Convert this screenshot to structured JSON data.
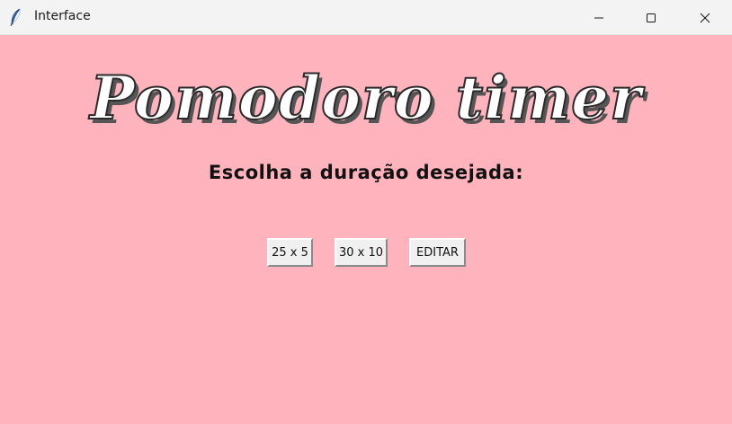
{
  "window": {
    "title": "Interface",
    "icon": "feather-icon",
    "controls": [
      "minimize-icon",
      "maximize-icon",
      "close-icon"
    ]
  },
  "main": {
    "heading": "Pomodoro timer",
    "subheading": "Escolha a duração desejada:",
    "buttons": {
      "option_25": "25 x 5",
      "option_30": "30 x 10",
      "edit": "EDITAR"
    }
  },
  "colors": {
    "background": "#ffb4bd",
    "titlebar": "#f3f3f3",
    "button": "#f0f0f0"
  }
}
